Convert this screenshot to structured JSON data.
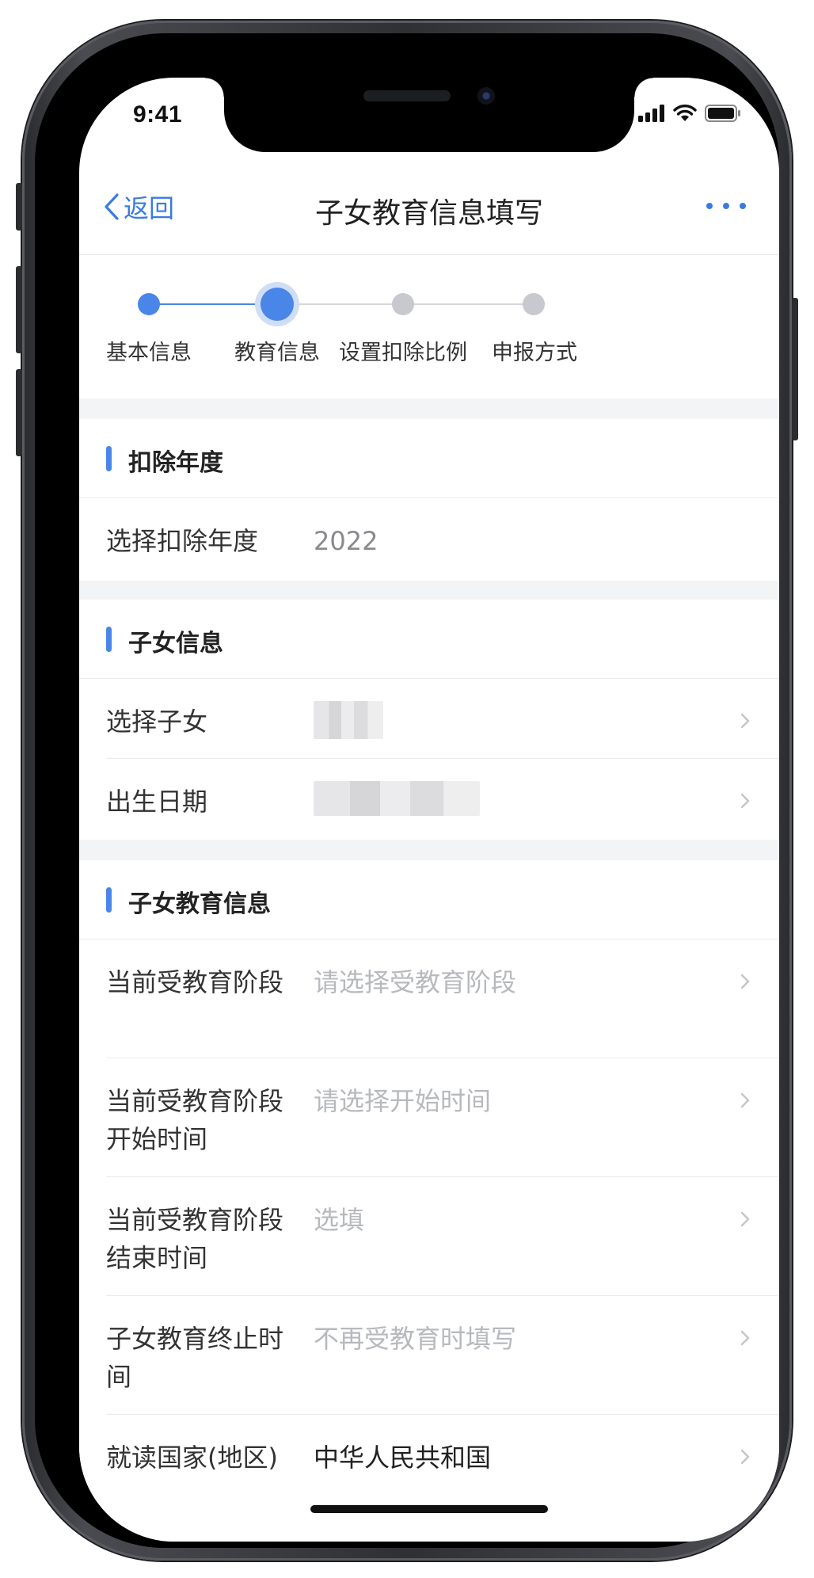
{
  "status_bar": {
    "time": "9:41"
  },
  "nav": {
    "back_label": "返回",
    "title": "子女教育信息填写"
  },
  "stepper": {
    "steps": [
      {
        "label": "基本信息",
        "state": "done"
      },
      {
        "label": "教育信息",
        "state": "current"
      },
      {
        "label": "设置扣除比例",
        "state": "pending"
      },
      {
        "label": "申报方式",
        "state": "pending"
      }
    ]
  },
  "sections": {
    "deduction_year": {
      "title": "扣除年度",
      "rows": [
        {
          "label": "选择扣除年度",
          "value": "2022"
        }
      ]
    },
    "child_info": {
      "title": "子女信息",
      "rows": [
        {
          "label": "选择子女",
          "value": ""
        },
        {
          "label": "出生日期",
          "value": ""
        }
      ]
    },
    "education_info": {
      "title": "子女教育信息",
      "rows": [
        {
          "label": "当前受教育阶段",
          "placeholder": "请选择受教育阶段"
        },
        {
          "label": "当前受教育阶段开始时间",
          "placeholder": "请选择开始时间"
        },
        {
          "label": "当前受教育阶段结束时间",
          "placeholder": "选填"
        },
        {
          "label": "子女教育终止时间",
          "placeholder": "不再受教育时填写"
        },
        {
          "label": "就读国家(地区)",
          "value": "中华人民共和国"
        }
      ]
    }
  },
  "colors": {
    "accent": "#3a7be0",
    "step_active": "#4a86e8",
    "step_pending": "#c8c9ce",
    "placeholder": "#b7b9bd",
    "page_gap": "#f3f4f6"
  }
}
